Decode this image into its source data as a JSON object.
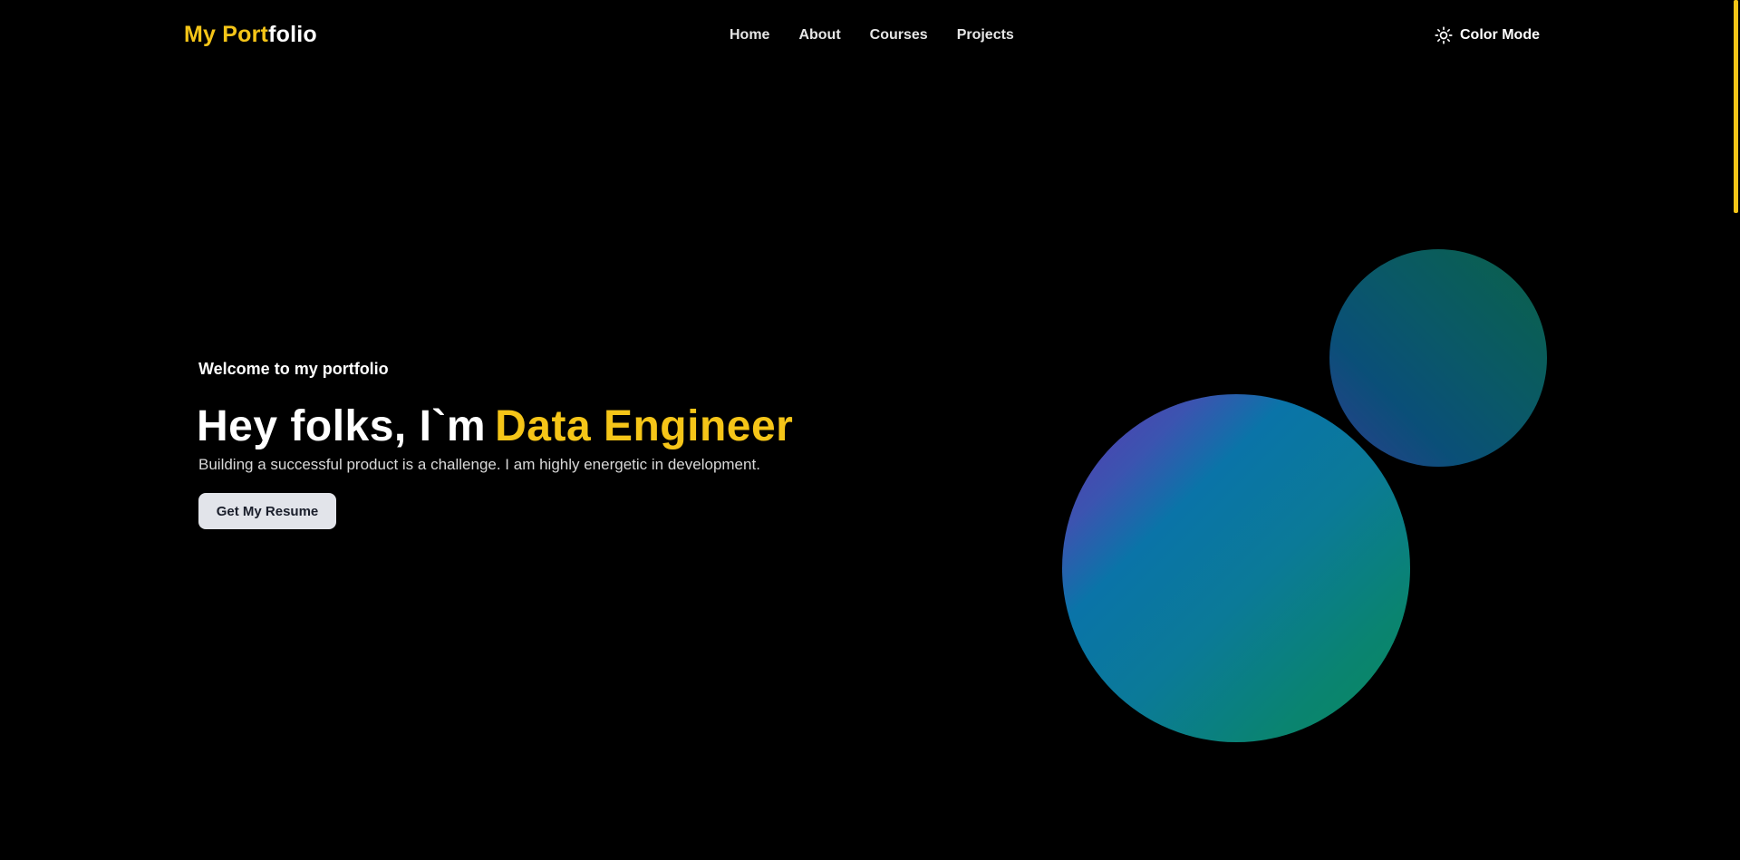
{
  "navbar": {
    "logo": {
      "accent": "My Port",
      "rest": "folio"
    },
    "links": [
      {
        "label": "Home"
      },
      {
        "label": "About"
      },
      {
        "label": "Courses"
      },
      {
        "label": "Projects"
      }
    ],
    "color_mode": {
      "label": "Color Mode",
      "icon": "sun-icon"
    }
  },
  "hero": {
    "welcome": "Welcome to my portfolio",
    "title_prefix": "Hey folks, I`m",
    "title_highlight": "Data Engineer",
    "subtitle": "Building a successful product is a challenge. I am highly energetic in development.",
    "cta_label": "Get My Resume"
  },
  "colors": {
    "background": "#000000",
    "accent": "#f5c518",
    "button_bg": "#e2e4ea",
    "button_text": "#1a1e2b"
  }
}
